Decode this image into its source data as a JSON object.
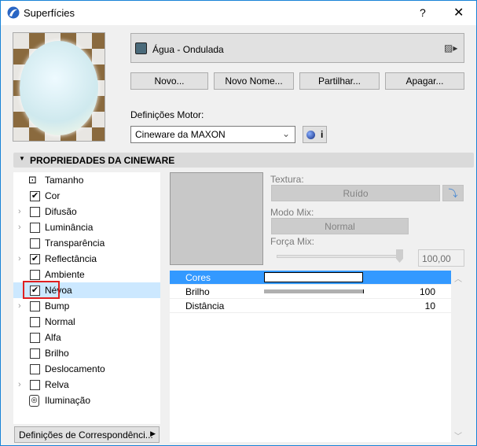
{
  "window": {
    "title": "Superfícies",
    "help": "?",
    "close": "✕"
  },
  "material": {
    "name": "Água - Ondulada",
    "swatch_color": "#4a6a7a"
  },
  "buttons": {
    "new": "Novo...",
    "rename": "Novo Nome...",
    "share": "Partilhar...",
    "delete": "Apagar..."
  },
  "engine": {
    "label": "Definições Motor:",
    "value": "Cineware da MAXON",
    "info": "i"
  },
  "section": {
    "title": "PROPRIEDADES DA CINEWARE"
  },
  "channels": [
    {
      "label": "Tamanho",
      "kind": "size",
      "expand": false
    },
    {
      "label": "Cor",
      "checked": true,
      "expand": false
    },
    {
      "label": "Difusão",
      "checked": false,
      "expand": true
    },
    {
      "label": "Luminância",
      "checked": false,
      "expand": true
    },
    {
      "label": "Transparência",
      "checked": false,
      "expand": false
    },
    {
      "label": "Reflectância",
      "checked": true,
      "expand": true
    },
    {
      "label": "Ambiente",
      "checked": false,
      "expand": false
    },
    {
      "label": "Névoa",
      "checked": true,
      "expand": false,
      "selected": true
    },
    {
      "label": "Bump",
      "checked": false,
      "expand": true
    },
    {
      "label": "Normal",
      "checked": false,
      "expand": false
    },
    {
      "label": "Alfa",
      "checked": false,
      "expand": false
    },
    {
      "label": "Brilho",
      "checked": false,
      "expand": false
    },
    {
      "label": "Deslocamento",
      "checked": false,
      "expand": false
    },
    {
      "label": "Relva",
      "checked": false,
      "expand": true
    },
    {
      "label": "Iluminação",
      "kind": "light",
      "expand": false
    }
  ],
  "mapping_button": "Definições de Correspondênci...",
  "texture": {
    "label": "Textura:",
    "value": "Ruído"
  },
  "mix_mode": {
    "label": "Modo Mix:",
    "value": "Normal"
  },
  "mix_strength": {
    "label": "Força Mix:",
    "value": "100,00",
    "slider_percent": 100
  },
  "params": [
    {
      "name": "Cores",
      "type": "color",
      "color": "#ffffff"
    },
    {
      "name": "Brilho",
      "value": "100",
      "bar_percent": 100
    },
    {
      "name": "Distância",
      "value": "10"
    }
  ]
}
